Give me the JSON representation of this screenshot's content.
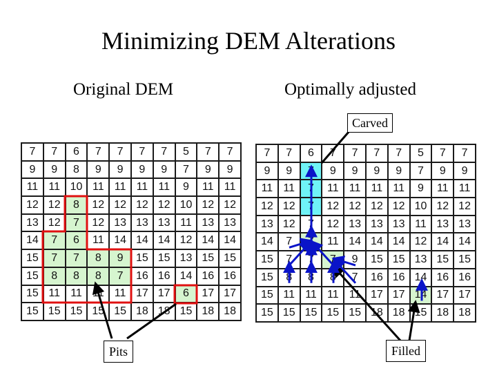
{
  "title": "Minimizing DEM Alterations",
  "left_panel": {
    "heading": "Original DEM",
    "grid": [
      [
        7,
        7,
        6,
        7,
        7,
        7,
        7,
        5,
        7,
        7
      ],
      [
        9,
        9,
        8,
        9,
        9,
        9,
        9,
        7,
        9,
        9
      ],
      [
        11,
        11,
        10,
        11,
        11,
        11,
        11,
        9,
        11,
        11
      ],
      [
        12,
        12,
        8,
        12,
        12,
        12,
        12,
        10,
        12,
        12
      ],
      [
        13,
        12,
        7,
        12,
        13,
        13,
        13,
        11,
        13,
        13
      ],
      [
        14,
        7,
        6,
        11,
        14,
        14,
        14,
        12,
        14,
        14
      ],
      [
        15,
        7,
        7,
        8,
        9,
        15,
        15,
        13,
        15,
        15
      ],
      [
        15,
        8,
        8,
        8,
        7,
        16,
        16,
        14,
        16,
        16
      ],
      [
        15,
        11,
        11,
        11,
        11,
        17,
        17,
        6,
        17,
        17
      ],
      [
        15,
        15,
        15,
        15,
        15,
        18,
        18,
        15,
        18,
        18
      ]
    ],
    "highlighted_cells": [
      [
        3,
        2
      ],
      [
        4,
        2
      ],
      [
        5,
        1
      ],
      [
        5,
        2
      ],
      [
        6,
        1
      ],
      [
        6,
        2
      ],
      [
        6,
        3
      ],
      [
        6,
        4
      ],
      [
        7,
        1
      ],
      [
        7,
        2
      ],
      [
        7,
        3
      ],
      [
        7,
        4
      ],
      [
        8,
        7
      ]
    ],
    "highlight_color": "#d6f5cf",
    "outline_color": "#e01010",
    "callout": "Pits"
  },
  "right_panel": {
    "heading": "Optimally adjusted",
    "grid": [
      [
        7,
        7,
        6,
        7,
        7,
        7,
        7,
        5,
        7,
        7
      ],
      [
        9,
        9,
        7,
        9,
        9,
        9,
        9,
        7,
        9,
        9
      ],
      [
        11,
        11,
        7,
        11,
        11,
        11,
        11,
        9,
        11,
        11
      ],
      [
        12,
        12,
        7,
        12,
        12,
        12,
        12,
        10,
        12,
        12
      ],
      [
        13,
        12,
        7,
        12,
        13,
        13,
        13,
        11,
        13,
        13
      ],
      [
        14,
        7,
        7,
        11,
        14,
        14,
        14,
        12,
        14,
        14
      ],
      [
        15,
        7,
        7,
        7,
        9,
        15,
        15,
        13,
        15,
        15
      ],
      [
        15,
        8,
        8,
        8,
        7,
        16,
        16,
        14,
        16,
        16
      ],
      [
        15,
        11,
        11,
        11,
        11,
        17,
        17,
        14,
        17,
        17
      ],
      [
        15,
        15,
        15,
        15,
        15,
        18,
        18,
        15,
        18,
        18
      ]
    ],
    "carved_cells": [
      [
        1,
        2
      ],
      [
        2,
        2
      ],
      [
        3,
        2
      ]
    ],
    "carved_color": "#6ff3f7",
    "filled_cells": [
      [
        5,
        2
      ],
      [
        6,
        3
      ],
      [
        8,
        7
      ]
    ],
    "filled_color": "#d6f5cf",
    "flow_arrow_color": "#0a14c8",
    "callout_top": "Carved",
    "callout_bottom": "Filled"
  }
}
